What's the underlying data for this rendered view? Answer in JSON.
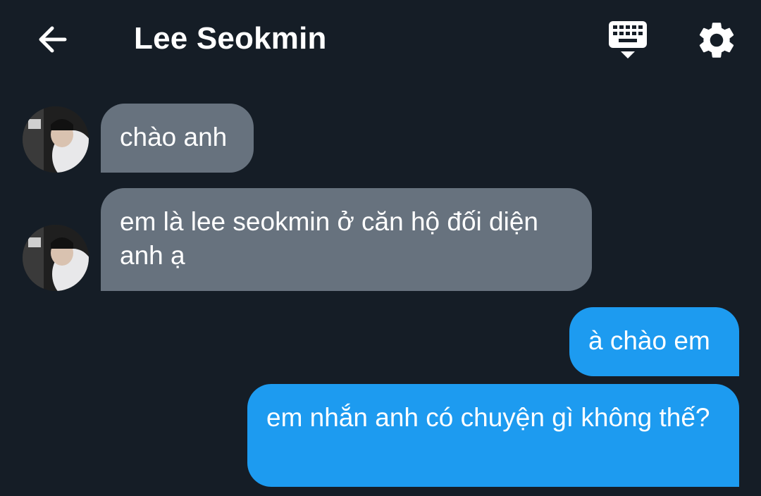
{
  "header": {
    "title": "Lee Seokmin",
    "back_icon": "arrow-left-icon",
    "keyboard_icon": "keyboard-hide-icon",
    "settings_icon": "gear-icon"
  },
  "colors": {
    "background": "#151d26",
    "incoming_bubble": "#67727e",
    "outgoing_bubble": "#1d9bf0",
    "text": "#ffffff"
  },
  "messages": [
    {
      "from": "contact",
      "text": "chào anh"
    },
    {
      "from": "contact",
      "text": "em là lee seokmin ở căn hộ đối diện anh ạ"
    },
    {
      "from": "me",
      "text": "à chào em"
    },
    {
      "from": "me",
      "text": "em nhắn anh có chuyện gì không thế?"
    }
  ]
}
